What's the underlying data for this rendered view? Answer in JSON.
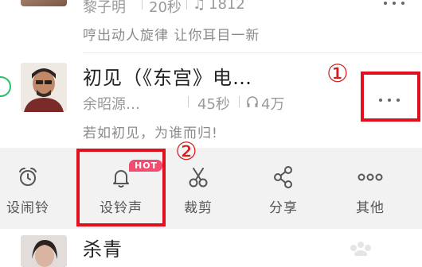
{
  "top_item": {
    "meta_artist": "黎子明",
    "meta_duration": "20秒",
    "meta_plays": "1812",
    "description": "哼出动人旋律 让你耳目一新"
  },
  "song": {
    "title": "初见（《东宫》电…",
    "artist": "余昭源…",
    "duration": "45秒",
    "plays": "4万",
    "description": "若如初见，为谁而归!"
  },
  "annotations": {
    "marker1": "①",
    "marker2": "②",
    "highlight_color": "#e0101e"
  },
  "toolbar": {
    "hot_badge": "HOT",
    "items": [
      {
        "label": "设闹铃",
        "icon": "alarm-clock-icon"
      },
      {
        "label": "设铃声",
        "icon": "bell-icon"
      },
      {
        "label": "裁剪",
        "icon": "scissors-icon"
      },
      {
        "label": "分享",
        "icon": "share-icon"
      },
      {
        "label": "其他",
        "icon": "more-icon"
      }
    ]
  },
  "bottom_item": {
    "title": "杀青"
  },
  "colors": {
    "toolbar_bg": "#f2f2f2",
    "hot_badge": "#f24c6e",
    "selected_ring": "#2bbf6a"
  }
}
